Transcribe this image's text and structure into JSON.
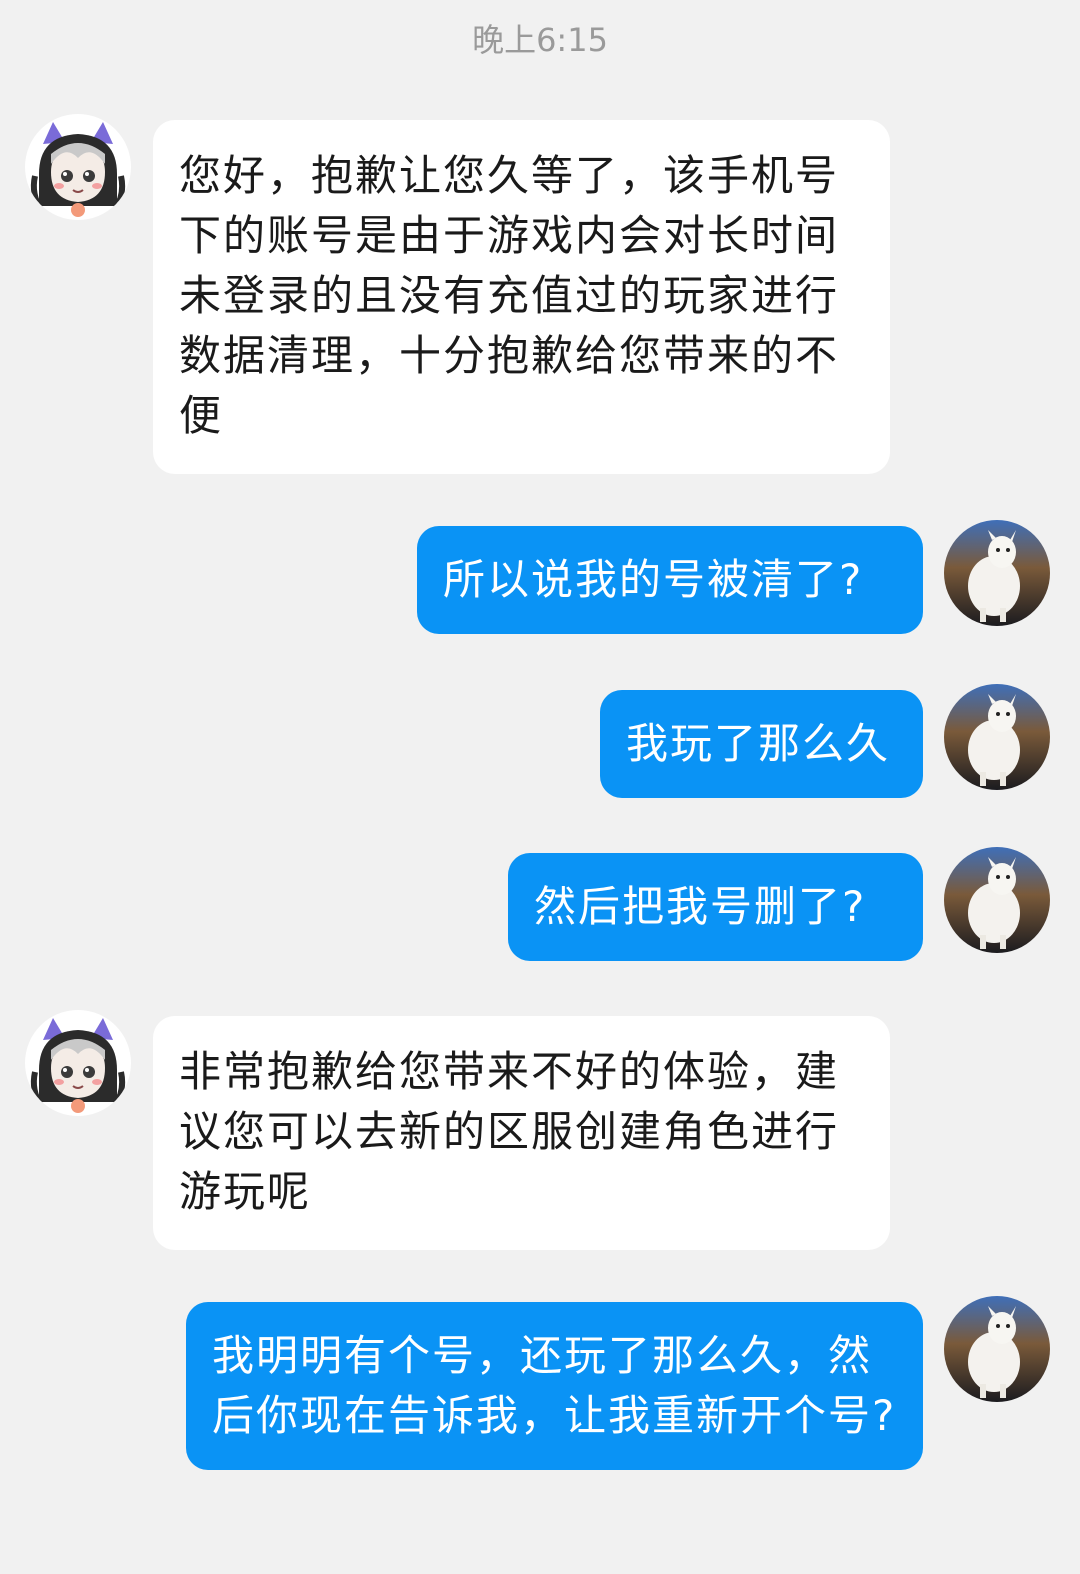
{
  "timestamp": "晚上6:15",
  "messages": [
    {
      "from": "agent",
      "text": "您好，抱歉让您久等了，该手机号下的账号是由于游戏内会对长时间未登录的且没有充值过的玩家进行数据清理，十分抱歉给您带来的不便"
    },
    {
      "from": "user",
      "text": "所以说我的号被清了?"
    },
    {
      "from": "user",
      "text": "我玩了那么久"
    },
    {
      "from": "user",
      "text": "然后把我号删了?"
    },
    {
      "from": "agent",
      "text": "非常抱歉给您带来不好的体验，建议您可以去新的区服创建角色进行游玩呢"
    },
    {
      "from": "user",
      "text": "我明明有个号，还玩了那么久，然后你现在告诉我，让我重新开个号?"
    }
  ],
  "avatars": {
    "agent": "anime-girl-avatar-icon",
    "user": "alpaca-avatar-icon"
  },
  "colors": {
    "background": "#f1f1f1",
    "incoming_bubble": "#ffffff",
    "outgoing_bubble": "#0a93f5"
  }
}
